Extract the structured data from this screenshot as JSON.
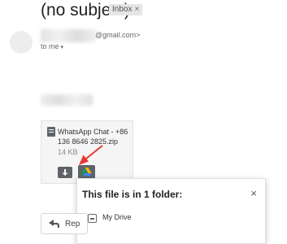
{
  "email": {
    "subject": "(no subject)",
    "label_chip": "Inbox",
    "label_chip_close": "×",
    "sender_email_suffix": "@gmail.com>",
    "recipient": "to me",
    "recipient_caret": "▾"
  },
  "attachment": {
    "file_name": "WhatsApp Chat - +86 136 8646 2825.zip",
    "file_size": "14 KB",
    "icons": [
      "file-icon",
      "download-icon",
      "google-drive-icon"
    ]
  },
  "drive_popup": {
    "title": "This file is in 1 folder:",
    "close": "×",
    "folders": [
      {
        "name": "My Drive",
        "icon": "drive-folder-icon"
      }
    ]
  },
  "actions": {
    "reply_label": "Rep"
  },
  "colors": {
    "annotation_arrow": "#e53935",
    "button_gray": "#5f6368",
    "drive_blue": "#4285f4",
    "drive_green": "#0f9d58",
    "drive_yellow": "#f4b400"
  }
}
